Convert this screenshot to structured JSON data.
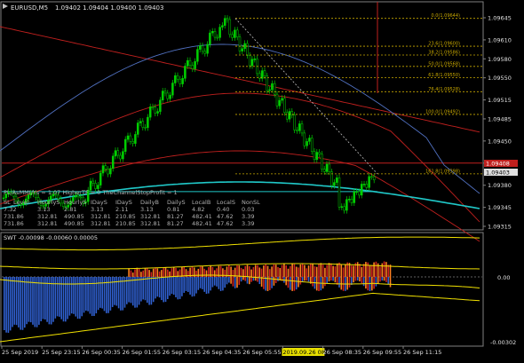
{
  "header": {
    "symbol_tf": "EURUSD,M5",
    "ohlc": "1.09402 1.09404 1.09400 1.09403"
  },
  "price_axis": {
    "labels": [
      "1.09645",
      "1.09610",
      "1.09580",
      "1.09550",
      "1.09515",
      "1.09485",
      "1.09450",
      "1.09415",
      "1.09380",
      "1.09345",
      "1.09315"
    ],
    "current_bid": "1.09408",
    "current_ask": "1.09403"
  },
  "fibo_levels": [
    {
      "label": "0.0(1.09644)",
      "value": 1.09644
    },
    {
      "label": "23.6(1.09600)",
      "value": 1.096
    },
    {
      "label": "38.2(1.09586)",
      "value": 1.09586
    },
    {
      "label": "50.0(1.09568)",
      "value": 1.09568
    },
    {
      "label": "61.8(1.09550)",
      "value": 1.0955
    },
    {
      "label": "76.4(1.09528)",
      "value": 1.09528
    },
    {
      "label": "100.0(1.09492)",
      "value": 1.09492
    },
    {
      "label": "161.8(1.09398)",
      "value": 1.09398
    }
  ],
  "info_panel": {
    "line1": "PL/AsMMI/Ys = 1.07          HigherTF = 0          TheChannelStopProfit = 1",
    "headers": [
      "SL_Level:",
      "HourlyS",
      "HourlyS",
      "IDayS",
      "IDayS",
      "DailyB",
      "DailyS",
      "LocalB",
      "LocalS",
      "NonSL"
    ],
    "row1": [
      "7.32",
      "3.13",
      "2.81",
      "3.13",
      "2.11",
      "3.13",
      "0.81",
      "4.82",
      "0.40",
      "0.03"
    ],
    "row2": [
      "731.86",
      "312.81",
      "490.85",
      "312.81",
      "210.85",
      "312.81",
      "81.27",
      "482.41",
      "47.62",
      "3.39"
    ],
    "row3": [
      "731.86",
      "312.81",
      "490.85",
      "312.81",
      "210.85",
      "312.81",
      "81.27",
      "482.41",
      "47.62",
      "3.39"
    ]
  },
  "indicator": {
    "title": "SWT -0.00098 -0.00060 0.00005",
    "axis_labels": [
      "0.00",
      "-0.00302"
    ]
  },
  "time_axis": {
    "labels": [
      "25 Sep 2019",
      "25 Sep 23:15",
      "26 Sep 00:35",
      "26 Sep 01:55",
      "26 Sep 03:15",
      "26 Sep 04:35",
      "26 Sep 05:55",
      "2019.09.26 08:00",
      "26 Sep 08:35",
      "26 Sep 09:55",
      "26 Sep 11:15"
    ],
    "highlight_index": 7
  },
  "colors": {
    "background": "#000000",
    "candle": "#00d000",
    "fibo": "#c8a800",
    "red_line": "#c0201e",
    "blue_line": "#5070c0",
    "cyan": "#20c8c8",
    "swt_orange": "#ff8020",
    "swt_red": "#d02020",
    "swt_blue": "#3060d0",
    "swt_yellow": "#f0e000",
    "highlight_bg": "#e8e000"
  }
}
